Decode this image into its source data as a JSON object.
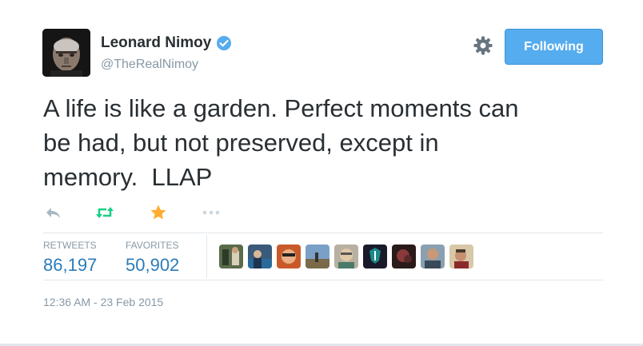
{
  "header": {
    "fullname": "Leonard Nimoy",
    "handle": "@TheRealNimoy",
    "follow_label": "Following",
    "verified_icon": "verified-badge-icon",
    "settings_icon": "gear-icon"
  },
  "tweet": {
    "text": "A life is like a garden. Perfect moments can\nbe had, but not preserved, except in\nmemory.  LLAP"
  },
  "actions": [
    {
      "icon": "reply-icon"
    },
    {
      "icon": "retweet-icon"
    },
    {
      "icon": "favorite-star-icon"
    },
    {
      "icon": "more-icon"
    }
  ],
  "stats": {
    "retweets_label": "RETWEETS",
    "retweets_value": "86,197",
    "favorites_label": "FAVORITES",
    "favorites_value": "50,902"
  },
  "favoriters": [
    {
      "name": "favoriter-avatar"
    },
    {
      "name": "favoriter-avatar"
    },
    {
      "name": "favoriter-avatar"
    },
    {
      "name": "favoriter-avatar"
    },
    {
      "name": "favoriter-avatar"
    },
    {
      "name": "favoriter-avatar"
    },
    {
      "name": "favoriter-avatar"
    },
    {
      "name": "favoriter-avatar"
    },
    {
      "name": "favoriter-avatar"
    }
  ],
  "timestamp": "12:36 AM - 23 Feb 2015",
  "colors": {
    "accent": "#55acee",
    "link": "#2b7bb9",
    "retweet_green": "#19cf86",
    "favorite_gold": "#ffac33",
    "muted": "#8899a6",
    "verified_blue": "#55acee"
  }
}
